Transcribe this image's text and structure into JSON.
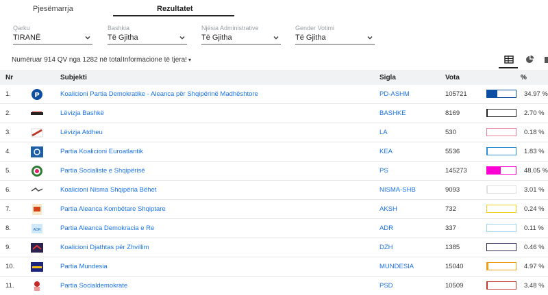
{
  "tabs": {
    "tab1": "Pjesëmarrja",
    "tab2": "Rezultatet"
  },
  "filters": {
    "qarku": {
      "label": "Qarku",
      "value": "TIRANË"
    },
    "bashkia": {
      "label": "Bashkia",
      "value": "Të Gjitha"
    },
    "njesia": {
      "label": "Njësia Administrative",
      "value": "Të Gjitha"
    },
    "gender": {
      "label": "Gender Votimi",
      "value": "Të Gjitha"
    }
  },
  "info": {
    "counted": "Numëruar 914 QV nga 1282 në total",
    "more": "Informacione të tjera!"
  },
  "table": {
    "headers": {
      "nr": "Nr",
      "subjekti": "Subjekti",
      "sigla": "Sigla",
      "vota": "Vota",
      "pct": "%"
    },
    "rows": [
      {
        "nr": "1.",
        "subjekti": "Koalicioni Partia Demokratike - Aleanca për Shqipërinë Madhështore",
        "sigla": "PD-ASHM",
        "vota": "105721",
        "pct": "34.97 %",
        "share": 0.3497,
        "color": "#0b4ea2",
        "logo": "pd-logo-icon"
      },
      {
        "nr": "2.",
        "subjekti": "Lëvizja Bashkë",
        "sigla": "BASHKE",
        "vota": "8169",
        "pct": "2.70 %",
        "share": 0.027,
        "color": "#222222",
        "logo": "bashke-logo-icon"
      },
      {
        "nr": "3.",
        "subjekti": "Lëvizja Atdheu",
        "sigla": "LA",
        "vota": "530",
        "pct": "0.18 %",
        "share": 0.0018,
        "color": "#e8829a",
        "logo": "la-logo-icon"
      },
      {
        "nr": "4.",
        "subjekti": "Partia Koalicioni Euroatlantik",
        "sigla": "KEA",
        "vota": "5536",
        "pct": "1.83 %",
        "share": 0.0183,
        "color": "#2b8fd6",
        "logo": "kea-logo-icon"
      },
      {
        "nr": "5.",
        "subjekti": "Partia Socialiste e Shqipërisë",
        "sigla": "PS",
        "vota": "145273",
        "pct": "48.05 %",
        "share": 0.4805,
        "color": "#ff00d4",
        "logo": "ps-logo-icon"
      },
      {
        "nr": "6.",
        "subjekti": "Koalicioni Nisma Shqipëria Bëhet",
        "sigla": "NISMA-SHB",
        "vota": "9093",
        "pct": "3.01 %",
        "share": 0.0301,
        "color": "#e0e0e0",
        "logo": "nisma-logo-icon"
      },
      {
        "nr": "7.",
        "subjekti": "Partia Aleanca Kombëtare Shqiptare",
        "sigla": "AKSH",
        "vota": "732",
        "pct": "0.24 %",
        "share": 0.0024,
        "color": "#f2d21c",
        "logo": "aksh-logo-icon"
      },
      {
        "nr": "8.",
        "subjekti": "Partia Aleanca Demokracia e Re",
        "sigla": "ADR",
        "vota": "337",
        "pct": "0.11 %",
        "share": 0.0011,
        "color": "#9fd3f0",
        "logo": "adr-logo-icon"
      },
      {
        "nr": "9.",
        "subjekti": "Koalicioni Djathtas për Zhvillim",
        "sigla": "DZH",
        "vota": "1385",
        "pct": "0.46 %",
        "share": 0.0046,
        "color": "#2a2350",
        "logo": "dzh-logo-icon"
      },
      {
        "nr": "10.",
        "subjekti": "Partia Mundesia",
        "sigla": "MUNDESIA",
        "vota": "15040",
        "pct": "4.97 %",
        "share": 0.0497,
        "color": "#f39c12",
        "logo": "mundesia-logo-icon"
      },
      {
        "nr": "11.",
        "subjekti": "Partia Socialdemokrate",
        "sigla": "PSD",
        "vota": "10509",
        "pct": "3.48 %",
        "share": 0.0348,
        "color": "#c0392b",
        "logo": "psd-logo-icon"
      }
    ]
  }
}
